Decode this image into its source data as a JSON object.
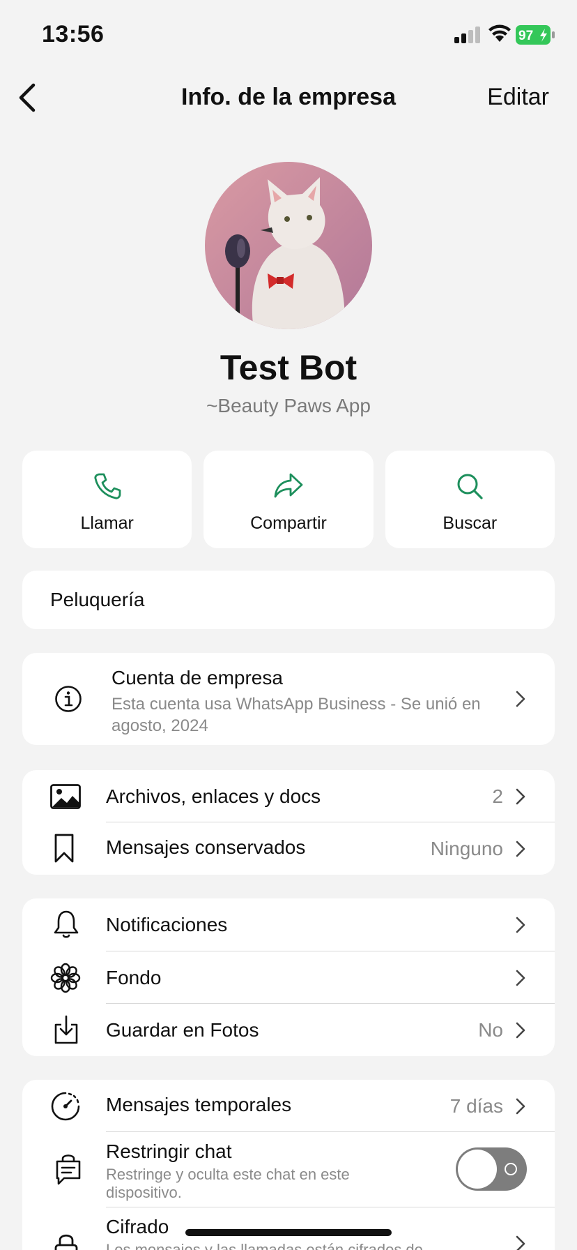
{
  "status": {
    "time": "13:56",
    "battery": "97"
  },
  "nav": {
    "title": "Info. de la empresa",
    "edit": "Editar"
  },
  "profile": {
    "name": "Test Bot",
    "subtitle": "~Beauty Paws App"
  },
  "actions": [
    {
      "label": "Llamar",
      "icon": "phone-icon"
    },
    {
      "label": "Compartir",
      "icon": "share-icon"
    },
    {
      "label": "Buscar",
      "icon": "search-icon"
    }
  ],
  "category": "Peluquería",
  "account": {
    "title": "Cuenta de empresa",
    "description": "Esta cuenta usa WhatsApp Business - Se unió en agosto, 2024"
  },
  "media": {
    "files_label": "Archivos, enlaces y docs",
    "files_value": "2",
    "kept_label": "Mensajes conservados",
    "kept_value": "Ninguno"
  },
  "settings": {
    "notifications": "Notificaciones",
    "wallpaper": "Fondo",
    "save_photos": "Guardar en Fotos",
    "save_photos_value": "No"
  },
  "privacy": {
    "disappearing": "Mensajes temporales",
    "disappearing_value": "7 días",
    "restrict": "Restringir chat",
    "restrict_desc": "Restringe y oculta este chat en este dispositivo.",
    "restrict_on": false,
    "encryption": "Cifrado",
    "encryption_desc": "Los mensajes y las llamadas están cifrados de"
  },
  "colors": {
    "accent": "#1d8f5c",
    "background": "#f3f3f3",
    "battery": "#34c759"
  }
}
